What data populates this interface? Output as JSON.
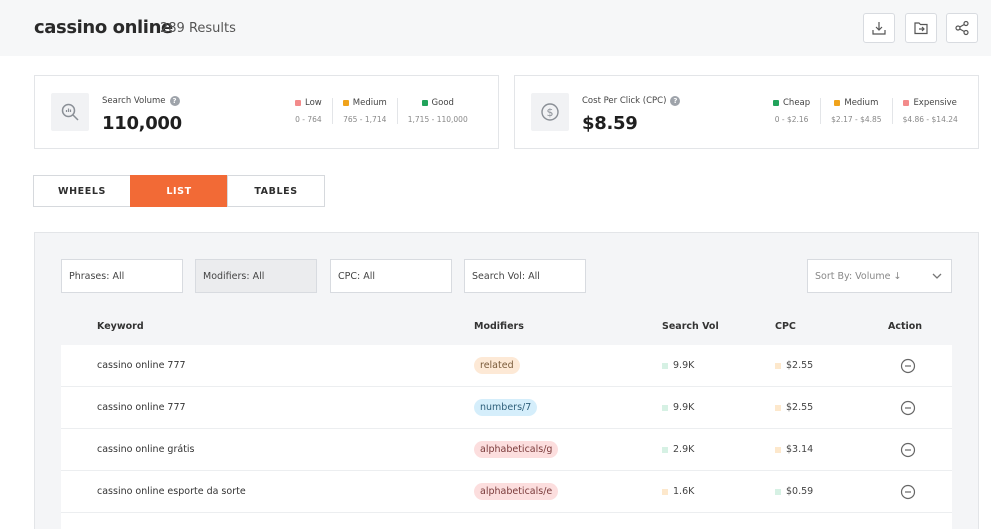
{
  "header": {
    "title": "cassino online",
    "results": "289 Results",
    "actions": [
      {
        "name": "download-icon"
      },
      {
        "name": "export-folder-icon"
      },
      {
        "name": "share-icon"
      }
    ]
  },
  "search_volume": {
    "label": "Search Volume",
    "value": "110,000",
    "icon": "search-volume-icon",
    "legend": [
      {
        "label": "Low",
        "range": "0 - 764",
        "color": "#f38b8b"
      },
      {
        "label": "Medium",
        "range": "765 - 1,714",
        "color": "#f0a31c"
      },
      {
        "label": "Good",
        "range": "1,715 - 110,000",
        "color": "#21a35b"
      }
    ]
  },
  "cpc": {
    "label": "Cost Per Click (CPC)",
    "value": "$8.59",
    "icon": "dollar-icon",
    "legend": [
      {
        "label": "Cheap",
        "range": "0 - $2.16",
        "color": "#21a35b"
      },
      {
        "label": "Medium",
        "range": "$2.17 - $4.85",
        "color": "#f0a31c"
      },
      {
        "label": "Expensive",
        "range": "$4.86 - $14.24",
        "color": "#f38b8b"
      }
    ]
  },
  "views": {
    "wheels": "WHEELS",
    "list": "LIST",
    "tables": "TABLES",
    "active": "list",
    "accent": "#f26a36"
  },
  "filters": {
    "phrases": "Phrases: All",
    "modifiers": "Modifiers: All",
    "cpc": "CPC: All",
    "search_vol": "Search Vol: All",
    "sort": "Sort By: Volume ↓"
  },
  "table": {
    "headers": {
      "keyword": "Keyword",
      "modifiers": "Modifiers",
      "search_vol": "Search Vol",
      "cpc": "CPC",
      "action": "Action"
    },
    "rows": [
      {
        "keyword": "cassino online 777",
        "modifier": "related",
        "modifier_type": "related",
        "search_vol": "9.9K",
        "sv_level": "green",
        "cpc": "$2.55",
        "cpc_level": "orange"
      },
      {
        "keyword": "cassino online 777",
        "modifier": "numbers/7",
        "modifier_type": "numbers",
        "search_vol": "9.9K",
        "sv_level": "green",
        "cpc": "$2.55",
        "cpc_level": "orange"
      },
      {
        "keyword": "cassino online grátis",
        "modifier": "alphabeticals/g",
        "modifier_type": "alpha",
        "search_vol": "2.9K",
        "sv_level": "green",
        "cpc": "$3.14",
        "cpc_level": "orange"
      },
      {
        "keyword": "cassino online esporte da sorte",
        "modifier": "alphabeticals/e",
        "modifier_type": "alpha",
        "search_vol": "1.6K",
        "sv_level": "orange",
        "cpc": "$0.59",
        "cpc_level": "green"
      }
    ]
  }
}
